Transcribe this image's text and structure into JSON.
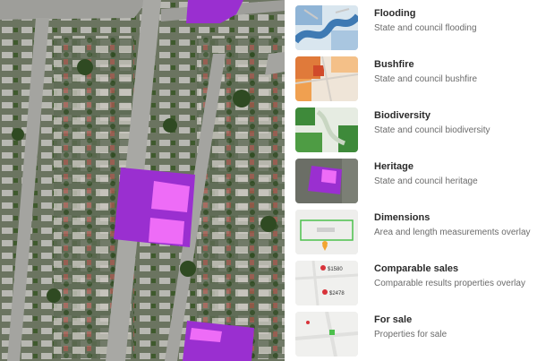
{
  "map": {
    "label": "Satellite map view",
    "colors": {
      "overlay_base": "#9a2fd0",
      "overlay_highlight": "#ee6cf7",
      "road": "#a9a9a9",
      "roof": "#cfcfcf",
      "foliage": "#3e5a2c"
    }
  },
  "layers": [
    {
      "id": "flooding",
      "title": "Flooding",
      "subtitle": "State and council flooding",
      "icon": "flood-map-thumbnail"
    },
    {
      "id": "bushfire",
      "title": "Bushfire",
      "subtitle": "State and council bushfire",
      "icon": "bushfire-map-thumbnail"
    },
    {
      "id": "biodiversity",
      "title": "Biodiversity",
      "subtitle": "State and council biodiversity",
      "icon": "biodiversity-map-thumbnail"
    },
    {
      "id": "heritage",
      "title": "Heritage",
      "subtitle": "State and council heritage",
      "icon": "heritage-map-thumbnail"
    },
    {
      "id": "dimensions",
      "title": "Dimensions",
      "subtitle": "Area and length measurements overlay",
      "icon": "dimensions-map-thumbnail"
    },
    {
      "id": "comparable-sales",
      "title": "Comparable sales",
      "subtitle": "Comparable results properties overlay",
      "icon": "comparable-sales-map-thumbnail",
      "price_labels": [
        "$1580",
        "$2478"
      ]
    },
    {
      "id": "for-sale",
      "title": "For sale",
      "subtitle": "Properties for sale",
      "icon": "for-sale-map-thumbnail"
    }
  ]
}
